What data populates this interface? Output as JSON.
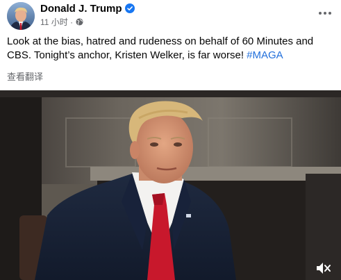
{
  "post": {
    "author": "Donald J. Trump",
    "time": "11 小时",
    "separator": "·",
    "body_text": "Look at the bias, hatred and rudeness on behalf of 60 Minutes and CBS. Tonight’s anchor, Kristen Welker, is far worse! ",
    "hashtag": "#MAGA",
    "translate_label": "查看翻译"
  },
  "icons": {
    "verified": "verified-badge-icon",
    "privacy": "globe-icon",
    "more": "more-options-icon",
    "mute": "muted-speaker-icon"
  },
  "colors": {
    "verified": "#1877f2",
    "hashtag": "#216fdb",
    "secondary_text": "#65676b"
  }
}
